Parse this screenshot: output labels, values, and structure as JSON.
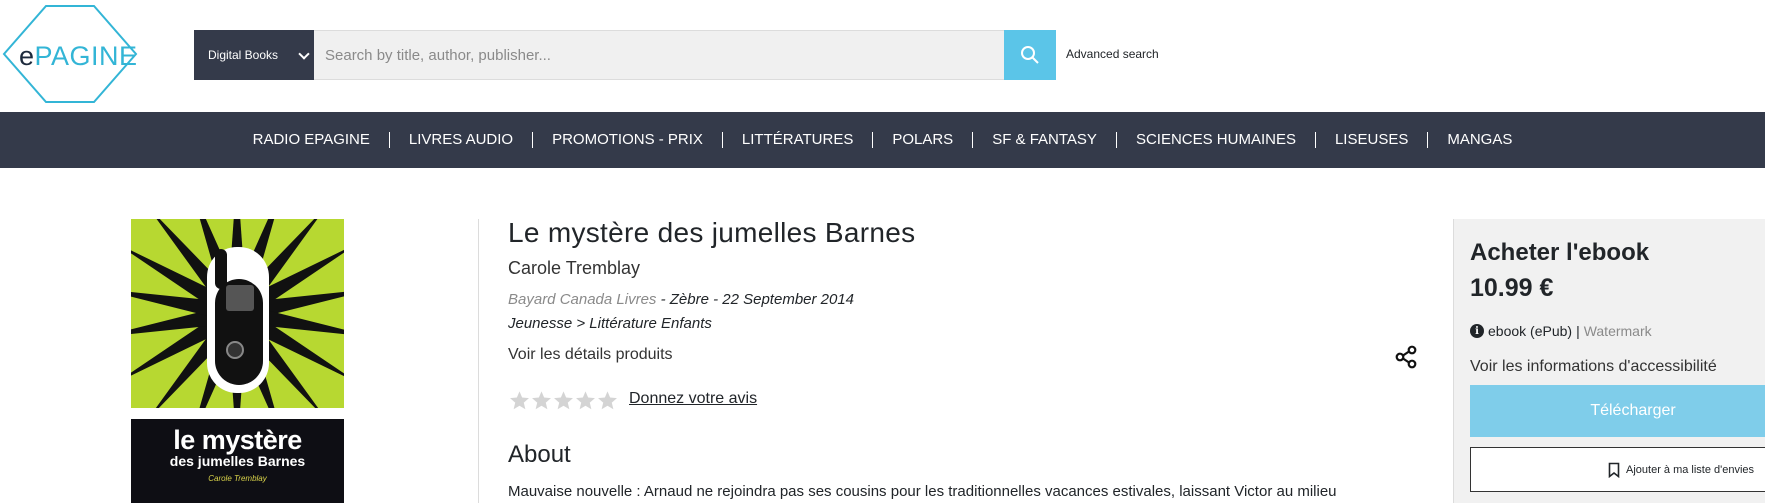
{
  "logo": {
    "prefix": "e",
    "brand": "PAGINE"
  },
  "search": {
    "category": "Digital Books",
    "placeholder": "Search by title, author, publisher...",
    "advanced": "Advanced search"
  },
  "nav": [
    "RADIO EPAGINE",
    "LIVRES AUDIO",
    "PROMOTIONS - PRIX",
    "LITTÉRATURES",
    "POLARS",
    "SF & FANTASY",
    "SCIENCES HUMAINES",
    "LISEUSES",
    "MANGAS"
  ],
  "cover": {
    "title_line1": "le mystère",
    "title_line2": "des jumelles Barnes",
    "author": "Carole Tremblay"
  },
  "book": {
    "title": "Le mystère des jumelles Barnes",
    "author": "Carole Tremblay",
    "publisher": "Bayard Canada Livres",
    "imprint_date": " - Zèbre - 22 September 2014",
    "category": "Jeunesse > Littérature Enfants",
    "details_link": "Voir les détails produits",
    "rating_stars": 5,
    "rating_filled": 0,
    "review_link": "Donnez votre avis",
    "about_heading": "About",
    "about_text": "Mauvaise nouvelle : Arnaud ne rejoindra pas ses cousins pour les traditionnelles vacances estivales, laissant Victor au milieu"
  },
  "buy": {
    "title": "Acheter l'ebook",
    "price": "10.99 €",
    "format": "ebook (ePub)",
    "separator": "|",
    "protection": "Watermark",
    "accessibility": "Voir les informations d'accessibilité",
    "download": "Télécharger",
    "wishlist": "Ajouter à ma liste d'envies"
  },
  "colors": {
    "navbar": "#343a4a",
    "accent": "#5bc5e8",
    "download": "#7fcdea",
    "cover_green": "#b7d831"
  }
}
